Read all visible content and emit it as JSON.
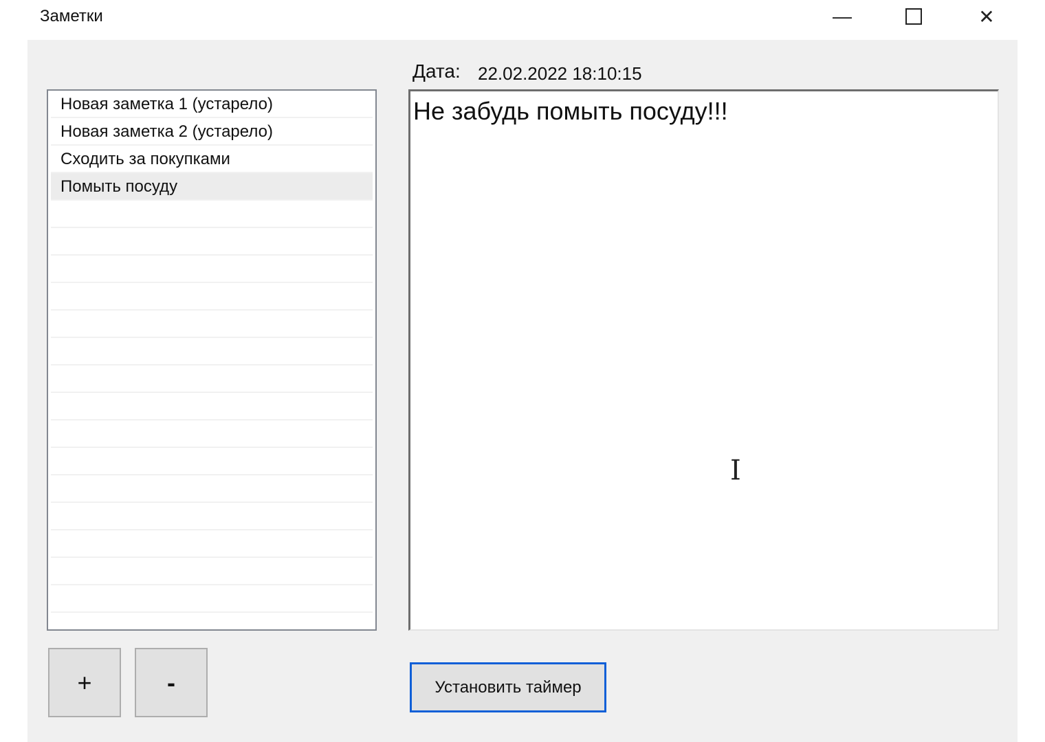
{
  "window": {
    "title": "Заметки",
    "minimize_icon": "minimize-icon",
    "maximize_icon": "maximize-icon",
    "close_icon": "close-icon"
  },
  "notes": {
    "items": [
      {
        "label": "Новая заметка 1 (устарело)"
      },
      {
        "label": "Новая заметка 2 (устарело)"
      },
      {
        "label": "Сходить за покупками"
      },
      {
        "label": "Помыть посуду",
        "selected": true
      }
    ]
  },
  "editor": {
    "date_label": "Дата:",
    "date_value": "22.02.2022 18:10:15",
    "content": "Не забудь помыть посуду!!!"
  },
  "buttons": {
    "add": "+",
    "remove": "-",
    "timer": "Установить таймер"
  },
  "colors": {
    "accent": "#0f5fd7",
    "background": "#f0f0f0"
  }
}
